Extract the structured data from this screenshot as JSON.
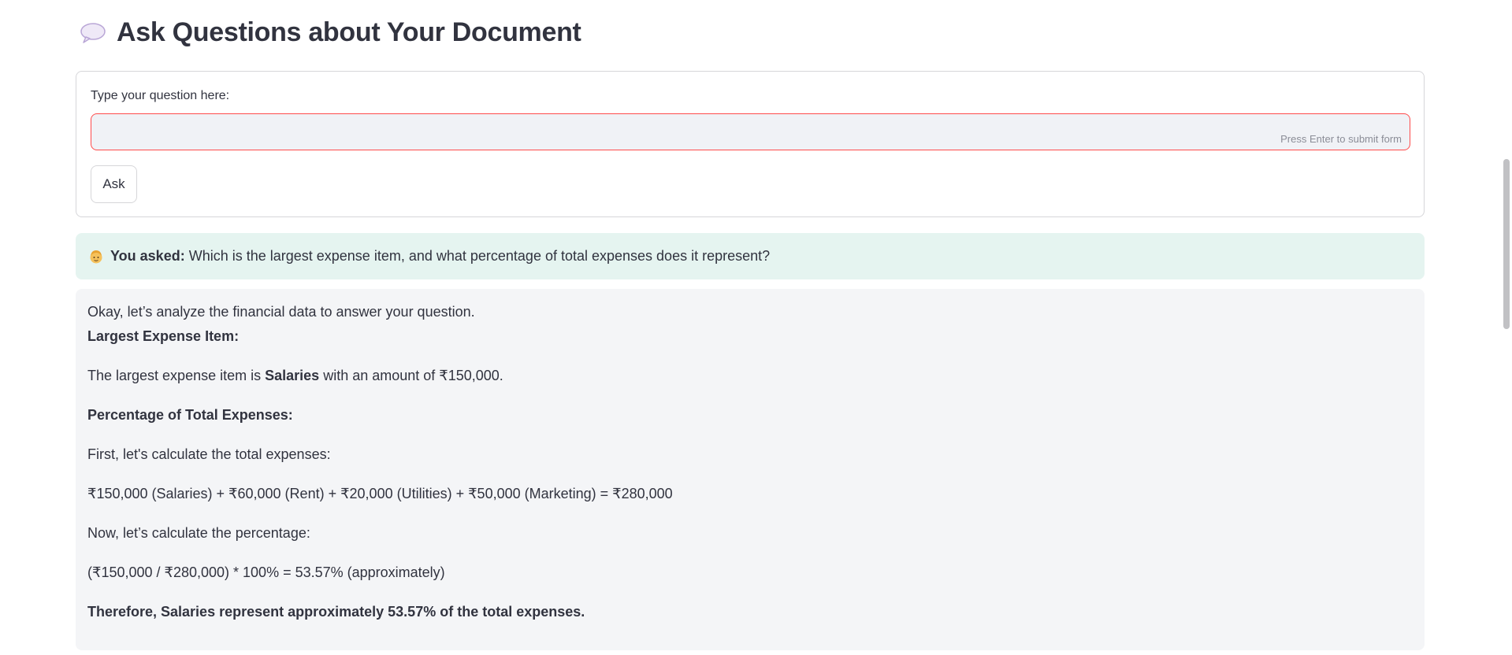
{
  "header": {
    "title": "Ask Questions about Your Document",
    "icon": "speech-balloon-icon"
  },
  "form": {
    "label": "Type your question here:",
    "input_value": "",
    "input_hint": "Press Enter to submit form",
    "ask_label": "Ask"
  },
  "asked": {
    "icon": "person-emoji-icon",
    "label": "You asked:",
    "question": "Which is the largest expense item, and what percentage of total expenses does it represent?"
  },
  "answer": {
    "intro": "Okay, let’s analyze the financial data to answer your question.",
    "heading1": "Largest Expense Item:",
    "line1_prefix": "The largest expense item is",
    "line1_bold": "Salaries",
    "line1_suffix": "with an amount of ₹150,000.",
    "heading2": "Percentage of Total Expenses:",
    "line2": "First, let's calculate the total expenses:",
    "line3": "₹150,000 (Salaries) + ₹60,000 (Rent) + ₹20,000 (Utilities) + ₹50,000 (Marketing) = ₹280,000",
    "line4": "Now, let’s calculate the percentage:",
    "line5": "(₹150,000 / ₹280,000) * 100% = 53.57% (approximately)",
    "conclusion": "Therefore, Salaries represent approximately 53.57% of the total expenses."
  },
  "colors": {
    "accent_error": "#ff4b4b",
    "asked_bg": "#e5f4f0",
    "answer_bg": "#f4f5f7",
    "text": "#31333f"
  }
}
